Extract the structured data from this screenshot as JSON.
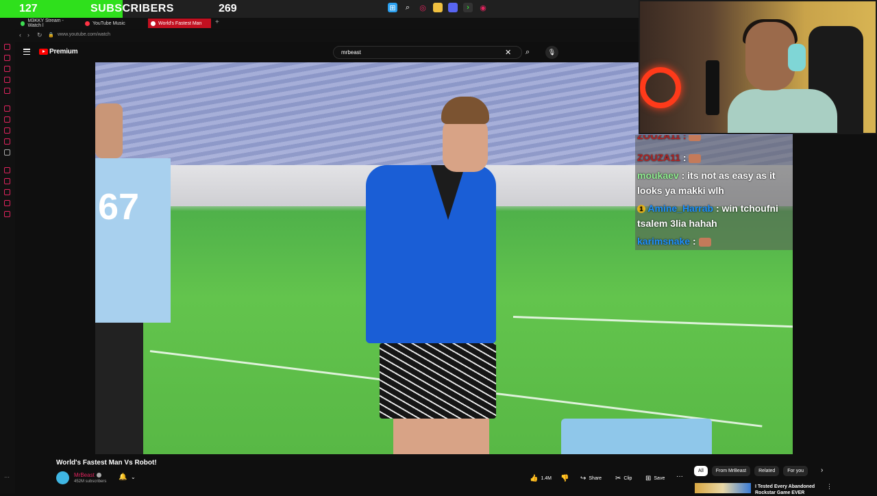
{
  "subscriber_goal": {
    "current": "127",
    "label": "SUBSCRIBERS",
    "goal": "269",
    "progress_fraction": 0.47,
    "bar_color": "#2fe01c"
  },
  "taskbar": {
    "icons": [
      "windows-start-icon",
      "search-icon",
      "opera-icon",
      "file-explorer-icon",
      "discord-icon",
      "terminal-icon",
      "browser-icon"
    ]
  },
  "browser": {
    "tabs": [
      {
        "label": "M3KKY Stream - Watch l",
        "icon": "twitch-icon"
      },
      {
        "label": "YouTube Music",
        "icon": "youtube-music-icon"
      },
      {
        "label": "World's Fastest Man",
        "icon": "youtube-icon",
        "active": true
      }
    ],
    "new_tab_label": "+",
    "url": "www.youtube.com/watch"
  },
  "youtube": {
    "brand": "Premium",
    "search": {
      "value": "mrbeast",
      "placeholder": "Search"
    },
    "video": {
      "title": "World's Fastest Man Vs Robot!",
      "channel": "MrBeast",
      "subscribers": "452M subscribers",
      "likes": "1.4M",
      "share_label": "Share",
      "clip_label": "Clip",
      "save_label": "Save"
    },
    "chips": [
      "All",
      "From MrBeast",
      "Related",
      "For you"
    ],
    "recommendation": {
      "title": "I Tested Every Abandoned Rockstar Game EVER"
    }
  },
  "chat": {
    "messages": [
      {
        "user": "ZOUZA11",
        "text": ":"
      },
      {
        "user": "moukaev",
        "text": ": its not as easy as it looks ya makki wlh"
      },
      {
        "user": "Amine_Harrab",
        "text": ": win tchoufni tsalem 3lia hahah",
        "badge": "1"
      },
      {
        "user": "karimsnake",
        "text": ":"
      }
    ]
  }
}
